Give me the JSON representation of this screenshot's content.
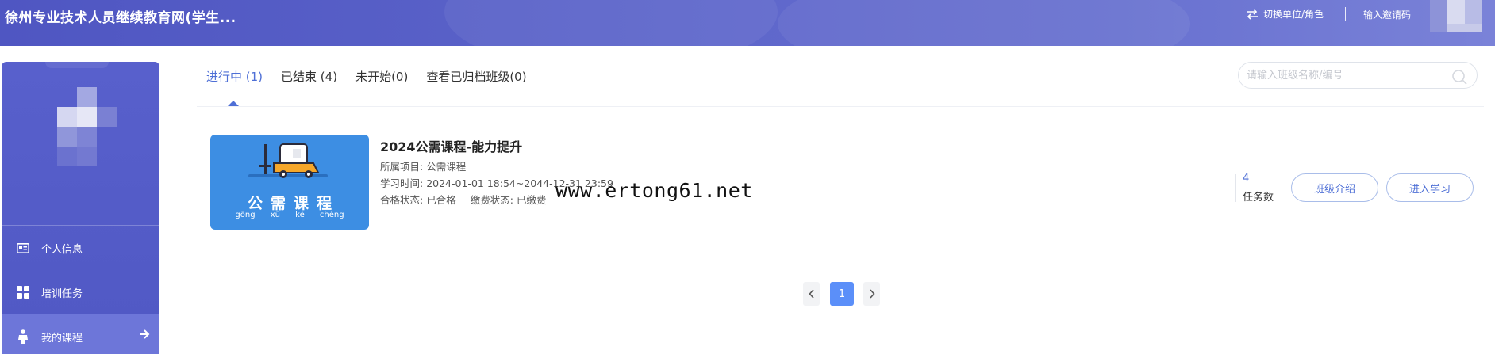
{
  "header": {
    "site_title": "徐州专业技术人员继续教育网(学生...",
    "switch_role_label": "切换单位/角色",
    "invite_code_label": "输入邀请码"
  },
  "sidebar": {
    "menu": [
      {
        "label": "个人信息",
        "icon": "id-card-icon"
      },
      {
        "label": "培训任务",
        "icon": "grid-apps-icon"
      },
      {
        "label": "我的课程",
        "icon": "person-icon",
        "active": true
      }
    ]
  },
  "tabs": [
    {
      "label": "进行中 (1)",
      "active": true
    },
    {
      "label": "已结束 (4)"
    },
    {
      "label": "未开始(0)"
    },
    {
      "label": "查看已归档班级(0)"
    }
  ],
  "search": {
    "placeholder": "请输入班级名称/编号"
  },
  "course": {
    "thumb_title": "公需课程",
    "thumb_pinyin": "gōng xū kè chéng",
    "title": "2024公需课程-能力提升",
    "project_label": "所属项目:",
    "project_value": "公需课程",
    "time_label": "学习时间:",
    "time_value": "2024-01-01 18:54~2044-12-31 23:59",
    "pass_label": "合格状态:",
    "pass_value": "已合格",
    "pay_label": "缴费状态:",
    "pay_value": "已缴费",
    "task_count": "4",
    "task_label": "任务数",
    "intro_button": "班级介绍",
    "study_button": "进入学习"
  },
  "pagination": {
    "current_page": "1",
    "prev_icon": "chevron-left-icon",
    "next_icon": "chevron-right-icon"
  },
  "watermark": "www.ertong61.net",
  "colors": {
    "header_bg": "#5b63c9",
    "sidebar_bg": "#5860cc",
    "accent": "#4e6fd6",
    "thumb_bg": "#3d8ee3",
    "page_active": "#5b8ff9"
  }
}
